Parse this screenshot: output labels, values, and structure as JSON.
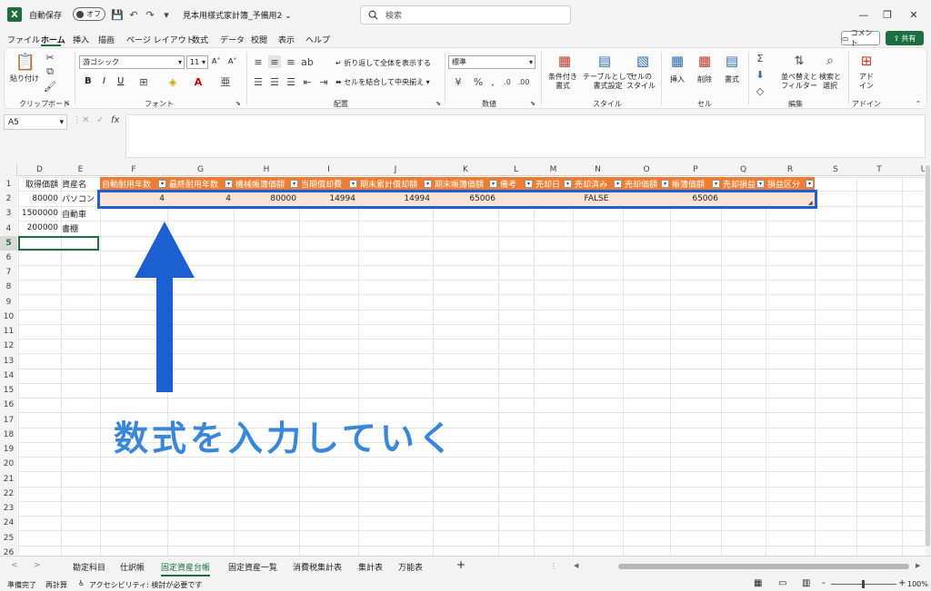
{
  "title_bar": {
    "app_letter": "X",
    "autosave_label": "自動保存",
    "autosave_state": "オフ",
    "save_icon": "💾",
    "undo_icon": "↶",
    "redo_icon": "↷",
    "customize_icon": "▾",
    "doc_title": "見本用様式家計簿_予備用2",
    "doc_title_chevron": "⌄",
    "search_placeholder": "検索",
    "win_minimize": "—",
    "win_restore": "❐",
    "win_close": "✕"
  },
  "menu": {
    "items": [
      "ファイル",
      "ホーム",
      "挿入",
      "描画",
      "ページ レイアウト",
      "数式",
      "データ",
      "校閲",
      "表示",
      "ヘルプ"
    ],
    "active": "ホーム",
    "comment_label": "コメント",
    "share_label": "共有"
  },
  "ribbon": {
    "clipboard": {
      "label": "クリップボード",
      "paste": "貼り付け"
    },
    "font": {
      "label": "フォント",
      "family": "游ゴシック",
      "size": "11",
      "grow": "A˄",
      "shrink": "A˅",
      "bold": "B",
      "italic": "I",
      "underline": "U"
    },
    "alignment": {
      "label": "配置",
      "wrap": "折り返して全体を表示する",
      "merge": "セルを結合して中央揃え"
    },
    "number": {
      "label": "数値",
      "format": "標準"
    },
    "styles": {
      "label": "スタイル",
      "cond": [
        "条件付き",
        "書式"
      ],
      "table": [
        "テーブルとして",
        "書式設定"
      ],
      "cell": [
        "セルの",
        "スタイル"
      ]
    },
    "cells": {
      "label": "セル",
      "insert": "挿入",
      "delete": "削除",
      "format": "書式"
    },
    "editing": {
      "label": "編集",
      "sort": [
        "並べ替えと",
        "フィルター"
      ],
      "find": [
        "検索と",
        "選択"
      ]
    },
    "addins": {
      "label": "アドイン",
      "name": [
        "アド",
        "イン"
      ]
    }
  },
  "formula_bar": {
    "name_box": "A5",
    "cancel": "✕",
    "enter": "✓",
    "fx": "fx",
    "formula": ""
  },
  "grid": {
    "columns": [
      "D",
      "E",
      "F",
      "G",
      "H",
      "I",
      "J",
      "K",
      "L",
      "M",
      "N",
      "O",
      "P",
      "Q",
      "R",
      "S",
      "T",
      "U"
    ],
    "rows": [
      "1",
      "2",
      "3",
      "4",
      "5",
      "6",
      "7",
      "8",
      "9",
      "10",
      "11",
      "12",
      "13",
      "14",
      "15",
      "16",
      "17",
      "18",
      "19",
      "20",
      "21",
      "22",
      "23",
      "24",
      "25",
      "26"
    ],
    "active_row": "5",
    "row1_plain": {
      "D": "取得価額",
      "E": "資産名"
    },
    "data_rows": [
      {
        "D": "80000",
        "E": "パソコン"
      },
      {
        "D": "1500000",
        "E": "自動車"
      },
      {
        "D": "200000",
        "E": "書棚"
      }
    ],
    "table_headers": [
      "自動耐用年数",
      "最終耐用年数",
      "機械帳簿価額",
      "当期償却費",
      "期末累計償却額",
      "期末帳簿価額",
      "備考",
      "売却日",
      "売却済み",
      "売却価額",
      "帳簿価額",
      "売却損益",
      "損益区分"
    ],
    "table_row": [
      "4",
      "4",
      "80000",
      "14994",
      "14994",
      "65006",
      "",
      "",
      "FALSE",
      "",
      "65006",
      "",
      ""
    ],
    "dropdown_glyph": "▾"
  },
  "annotation": "数式を入力していく",
  "sheet_tabs": {
    "tabs": [
      "勘定科目",
      "仕訳帳",
      "固定資産台帳",
      "固定資産一覧",
      "消費税集計表",
      "集計表",
      "万能表"
    ],
    "active": "固定資産台帳",
    "add": "+",
    "prev": "<",
    "next": ">"
  },
  "status_bar": {
    "ready": "準備完了",
    "recalc": "再計算",
    "accessibility": "アクセシビリティ: 検討が必要です",
    "zoom": "100%",
    "zoom_minus": "-",
    "zoom_plus": "+"
  },
  "colors": {
    "excel_green": "#1d6f42",
    "table_header": "#ef7d31",
    "table_row": "#fbe3d4",
    "highlight_border": "#1f5fd1",
    "arrow": "#1b5fd0",
    "annotation": "#3a86d8"
  }
}
